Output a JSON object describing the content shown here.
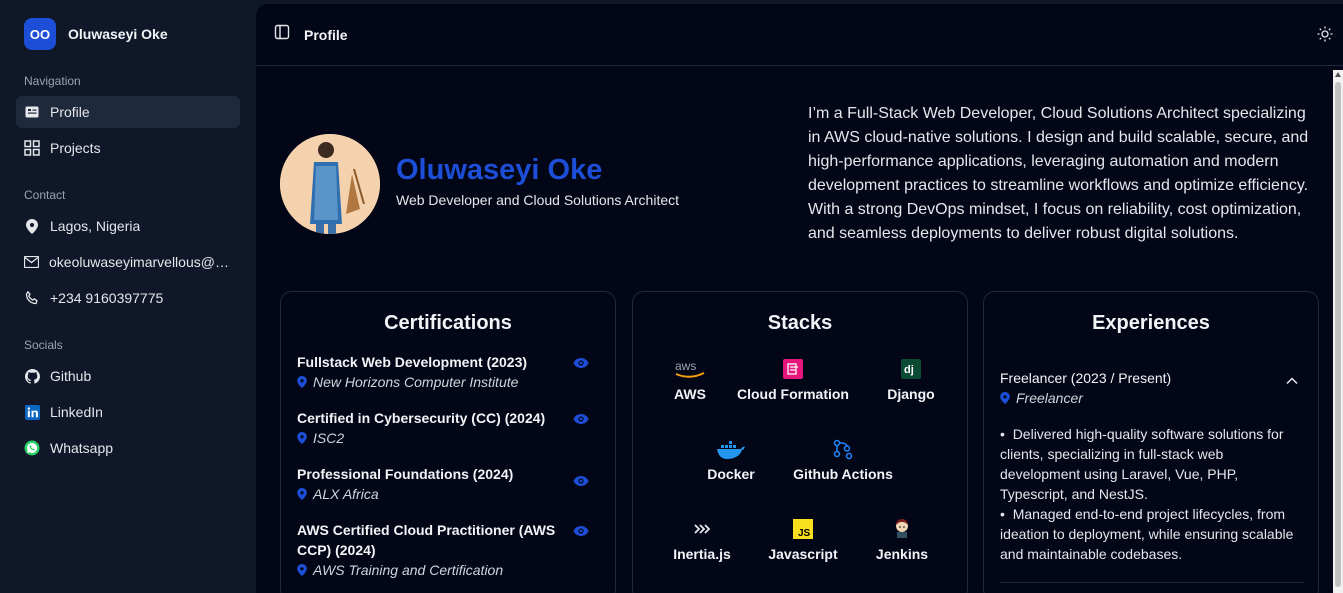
{
  "brand": {
    "initials": "OO",
    "name": "Oluwaseyi Oke"
  },
  "sidebar": {
    "navigation_label": "Navigation",
    "nav": [
      {
        "label": "Profile",
        "icon": "id-card-icon",
        "active": true
      },
      {
        "label": "Projects",
        "icon": "grid-icon",
        "active": false
      }
    ],
    "contact_label": "Contact",
    "contact": [
      {
        "label": "Lagos, Nigeria",
        "icon": "map-pin-icon"
      },
      {
        "label": "okeoluwaseyimarvellous@gmail.com",
        "icon": "mail-icon"
      },
      {
        "label": "+234 9160397775",
        "icon": "phone-icon"
      }
    ],
    "socials_label": "Socials",
    "socials": [
      {
        "label": "Github",
        "icon": "github-icon"
      },
      {
        "label": "LinkedIn",
        "icon": "linkedin-icon"
      },
      {
        "label": "Whatsapp",
        "icon": "whatsapp-icon"
      }
    ]
  },
  "header": {
    "title": "Profile"
  },
  "profile": {
    "name": "Oluwaseyi Oke",
    "role": "Web Developer and Cloud Solutions Architect",
    "bio": "I’m a Full-Stack Web Developer, Cloud Solutions Architect specializing in AWS cloud-native solutions. I design and build scalable, secure, and high-performance applications, leveraging automation and modern development practices to streamline workflows and optimize efficiency. With a strong DevOps mindset, I focus on reliability, cost optimization, and seamless deployments to deliver robust digital solutions."
  },
  "certifications": {
    "title": "Certifications",
    "items": [
      {
        "name": "Fullstack Web Development (2023)",
        "issuer": "New Horizons Computer Institute"
      },
      {
        "name": "Certified in Cybersecurity (CC) (2024)",
        "issuer": "ISC2"
      },
      {
        "name": "Professional Foundations (2024)",
        "issuer": "ALX Africa"
      },
      {
        "name": "AWS Certified Cloud Practitioner (AWS CCP) (2024)",
        "issuer": "AWS Training and Certification"
      }
    ]
  },
  "stacks": {
    "title": "Stacks",
    "items": [
      "AWS",
      "Cloud Formation",
      "Django",
      "Docker",
      "Github Actions",
      "Inertia.js",
      "Javascript",
      "Jenkins"
    ]
  },
  "experiences": {
    "title": "Experiences",
    "items": [
      {
        "role": "Freelancer (2023 / Present)",
        "company": "Freelancer",
        "bullets": [
          "Delivered high-quality software solutions for clients, specializing in full-stack web development using Laravel, Vue, PHP, Typescript, and NestJS.",
          "Managed end-to-end project lifecycles, from ideation to deployment, while ensuring scalable and maintainable codebases."
        ]
      }
    ]
  },
  "colors": {
    "accent": "#1d4ed8",
    "sidebar_bg": "#0f1729",
    "main_bg": "#020617"
  }
}
